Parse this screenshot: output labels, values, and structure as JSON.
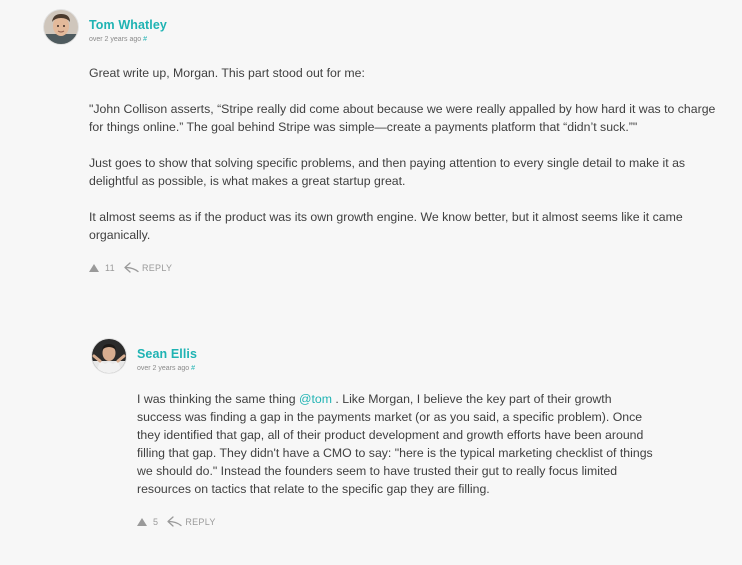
{
  "comments": [
    {
      "author": "Tom Whatley",
      "time": "over 2 years ago",
      "permalink": "#",
      "paragraphs": [
        "Great write up, Morgan. This part stood out for me:",
        "\"John Collison asserts, “Stripe really did come about because we were really appalled by how hard it was to charge for things online.” The goal behind Stripe was simple—create a payments platform that “didn’t suck.”\"",
        "Just goes to show that solving specific problems, and then paying attention to every single detail to make it as delightful as possible, is what makes a great startup great.",
        "It almost seems as if the product was its own growth engine. We know better, but it almost seems like it came organically."
      ],
      "votes": "11",
      "reply_label": "REPLY"
    },
    {
      "author": "Sean Ellis",
      "time": "over 2 years ago",
      "permalink": "#",
      "text_before_mention": "I was thinking the same thing ",
      "mention": "@tom",
      "text_after_mention": " . Like Morgan, I believe the key part of their growth success was finding a gap in the payments market (or as you said, a specific problem). Once they identified that gap, all of their product development and growth efforts have been around filling that gap. They didn't have a CMO to say: \"here is the typical marketing checklist of things we should do.\" Instead the founders seem to have trusted their gut to really focus limited resources on tactics that relate to the specific gap they are filling.",
      "votes": "5",
      "reply_label": "REPLY"
    }
  ],
  "colors": {
    "accent": "#1fb3b3",
    "text": "#3f3f3f",
    "muted": "#9a9a9a",
    "background": "#f7f7f7"
  },
  "icons": [
    "upvote-triangle-icon",
    "reply-arrow-icon"
  ]
}
